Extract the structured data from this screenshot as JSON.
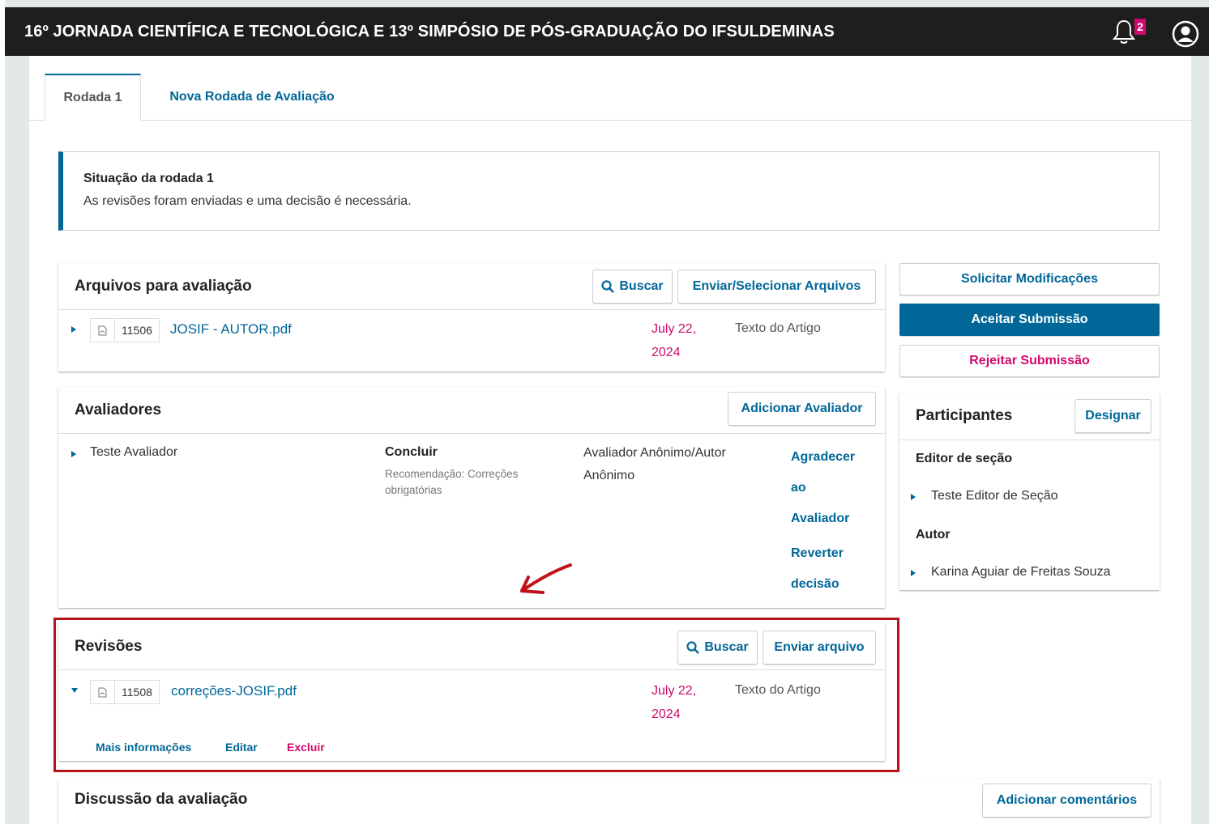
{
  "header": {
    "title": "16º JORNADA CIENTÍFICA E TECNOLÓGICA E 13º SIMPÓSIO DE PÓS-GRADUAÇÃO DO IFSULDEMINAS",
    "notifications_count": "2",
    "bell_icon": "bell-icon",
    "user_icon": "user-circle-icon"
  },
  "tabs": [
    {
      "label": "Rodada 1",
      "active": true
    },
    {
      "label": "Nova Rodada de Avaliação",
      "active": false
    }
  ],
  "notice": {
    "heading": "Situação da rodada 1",
    "text": "As revisões foram enviadas e uma decisão é necessária."
  },
  "review_files": {
    "title": "Arquivos para avaliação",
    "search_label": "Buscar",
    "upload_label": "Enviar/Selecionar Arquivos",
    "files": [
      {
        "id": "11506",
        "name": "JOSIF - AUTOR.pdf",
        "date_line1": "July 22,",
        "date_line2": "2024",
        "type": "Texto do Artigo"
      }
    ]
  },
  "reviewers": {
    "title": "Avaliadores",
    "add_label": "Adicionar Avaliador",
    "rows": [
      {
        "name": "Teste Avaliador",
        "status": "Concluir",
        "recommendation_line1": "Recomendação: Correções",
        "recommendation_line2": "obrigatórias",
        "method_line1": "Avaliador Anônimo/Autor",
        "method_line2": "Anônimo",
        "action1_line1": "Agradecer",
        "action1_line2": "ao",
        "action1_line3": "Avaliador",
        "action2_line1": "Reverter",
        "action2_line2": "decisão"
      }
    ]
  },
  "revisions": {
    "title": "Revisões",
    "search_label": "Buscar",
    "upload_label": "Enviar arquivo",
    "files": [
      {
        "id": "11508",
        "name": "correções-JOSIF.pdf",
        "date_line1": "July 22,",
        "date_line2": "2024",
        "type": "Texto do Artigo"
      }
    ],
    "actions": {
      "more": "Mais informações",
      "edit": "Editar",
      "delete": "Excluir"
    }
  },
  "discussion": {
    "title": "Discussão da avaliação",
    "add_label": "Adicionar comentários"
  },
  "decisions": {
    "request": "Solicitar Modificações",
    "accept": "Aceitar Submissão",
    "reject": "Rejeitar Submissão"
  },
  "participants": {
    "title": "Participantes",
    "assign_label": "Designar",
    "groups": [
      {
        "role": "Editor de seção",
        "member": "Teste Editor de Seção"
      },
      {
        "role": "Autor",
        "member": "Karina Aguiar de Freitas Souza"
      }
    ]
  },
  "colors": {
    "primary": "#006798",
    "accent": "#d00a6c",
    "highlight": "#b5121b",
    "header_bg": "#1e1e1e"
  }
}
